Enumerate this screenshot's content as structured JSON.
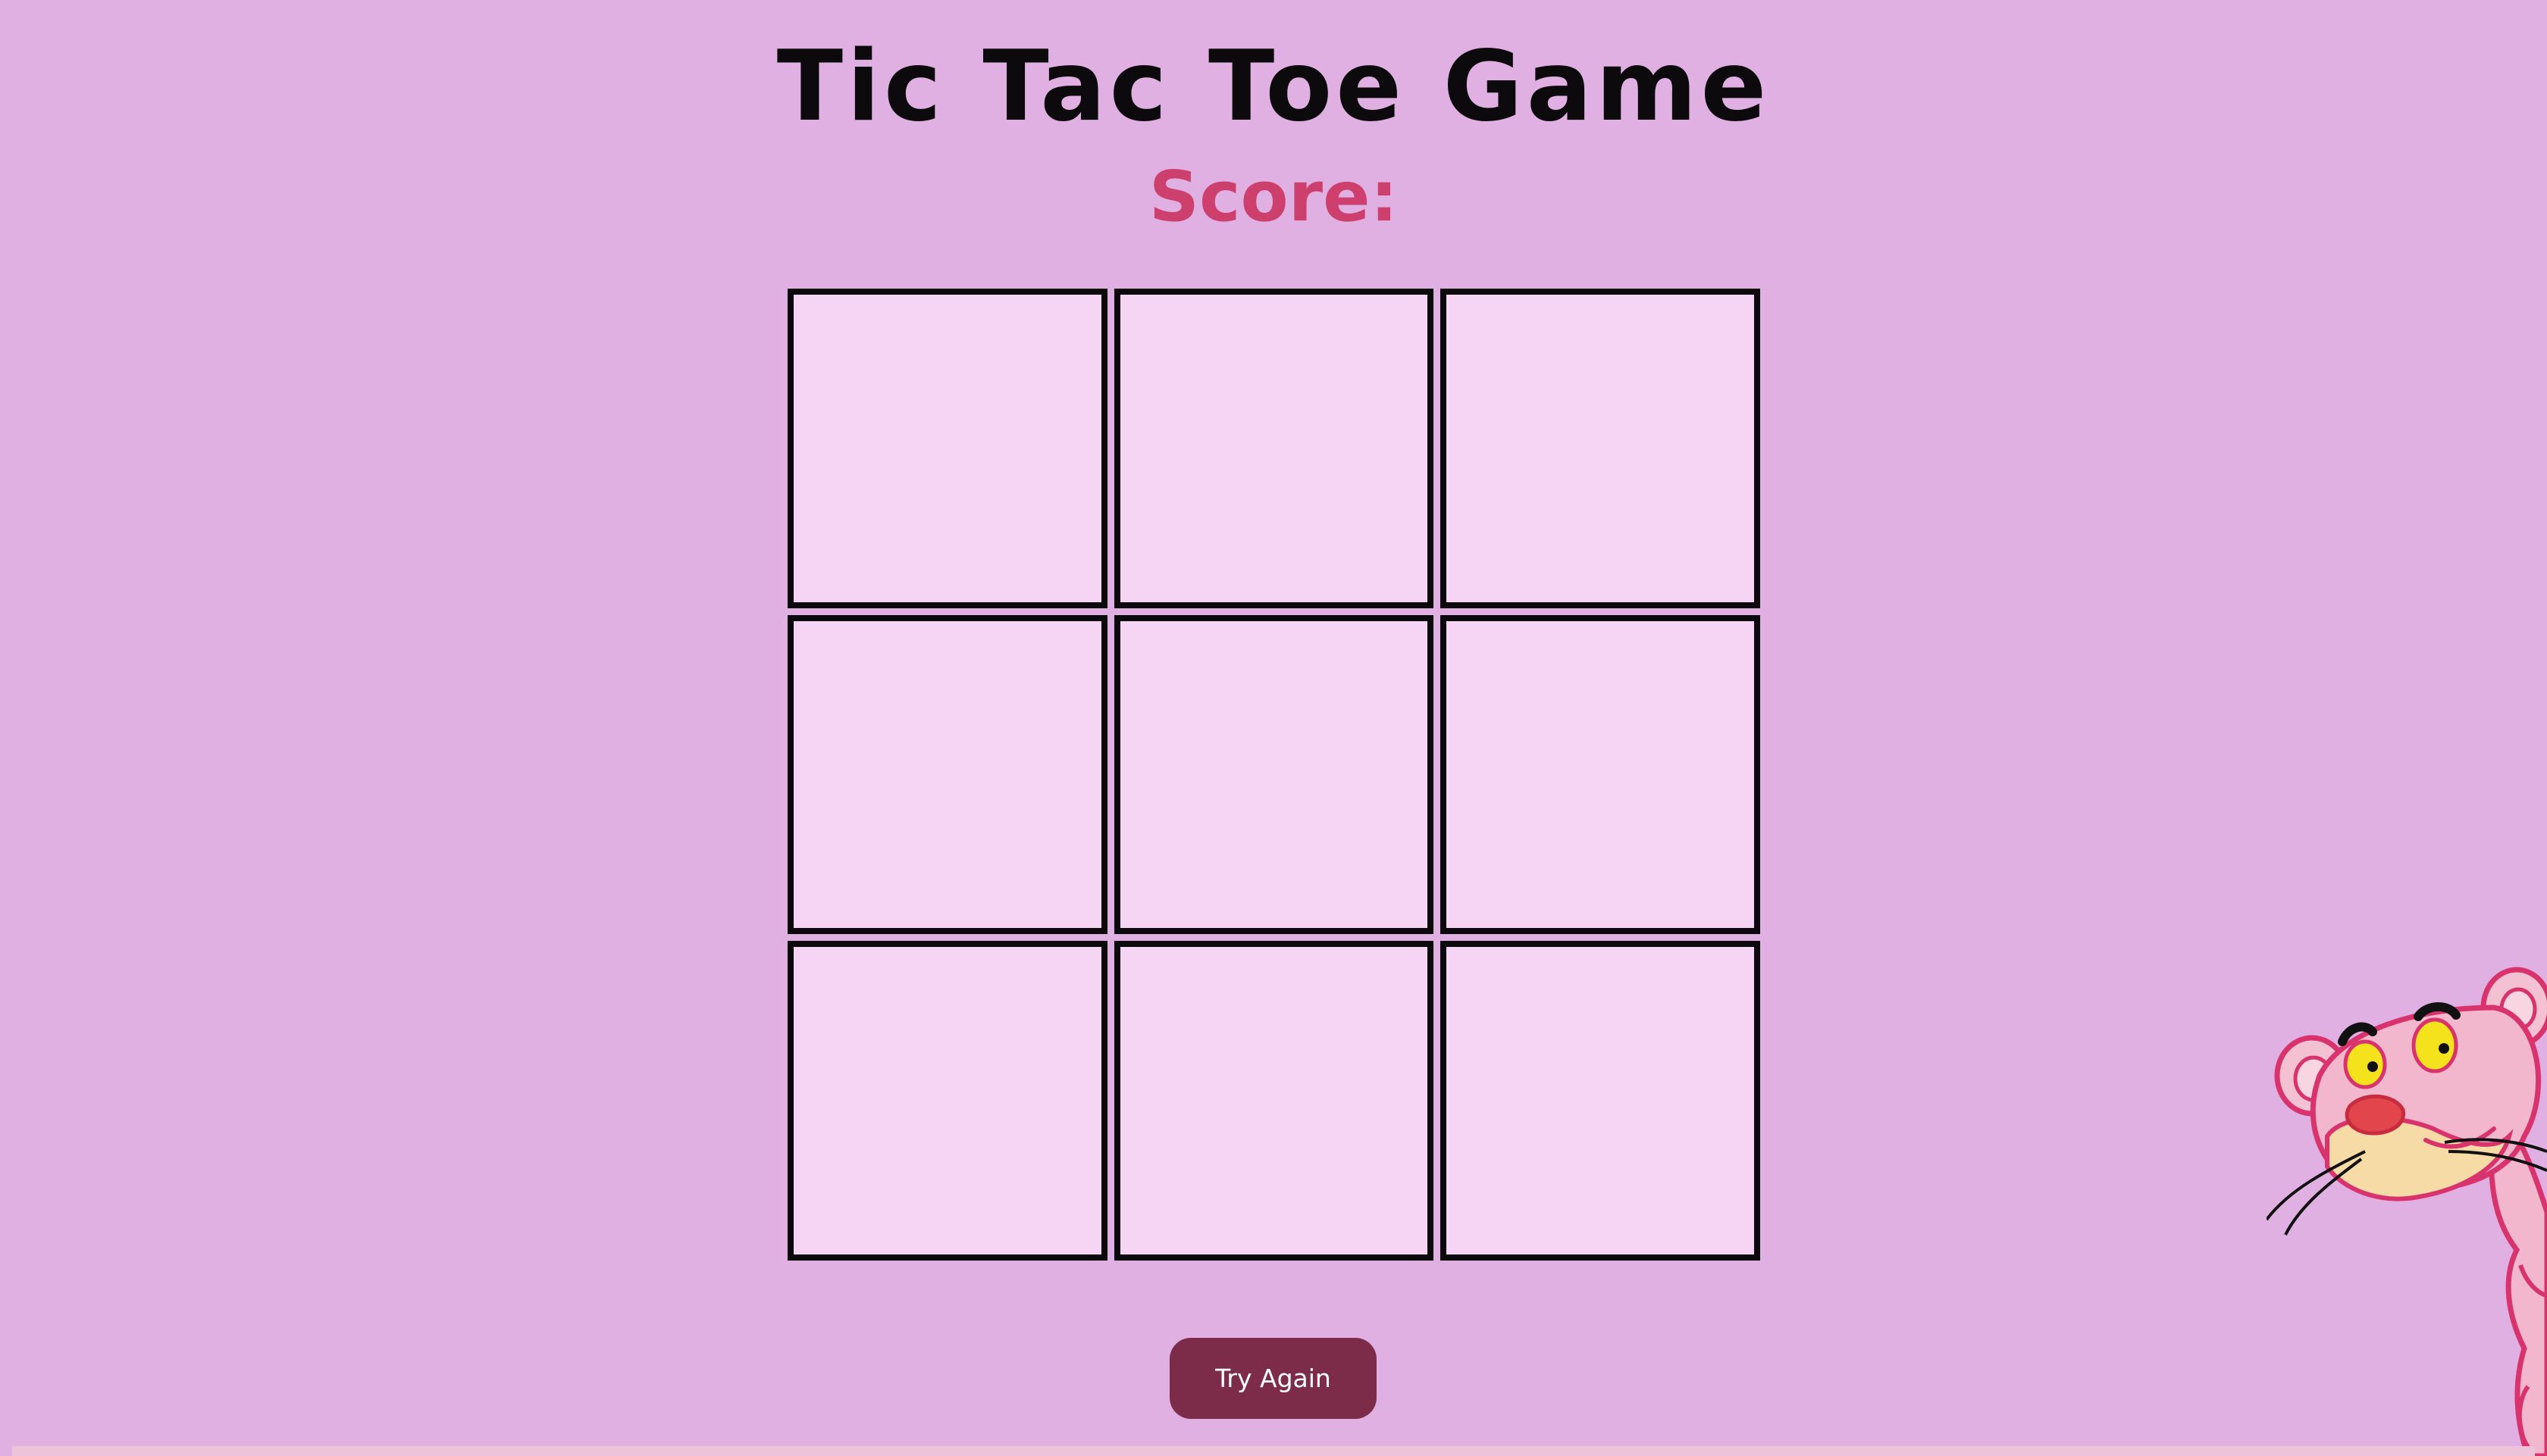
{
  "page": {
    "title": "Tic Tac Toe Game",
    "score_label": "Score:"
  },
  "board": {
    "cells": [
      "",
      "",
      "",
      "",
      "",
      "",
      "",
      "",
      ""
    ]
  },
  "controls": {
    "try_again_label": "Try Again"
  },
  "colors": {
    "background": "#dfb0e1",
    "cell": "#f5d4f4",
    "cell_border": "#0b090b",
    "score_text": "#cd3f6c",
    "button": "#7c2b48"
  },
  "decoration": {
    "character_icon": "pink-panther-icon"
  }
}
